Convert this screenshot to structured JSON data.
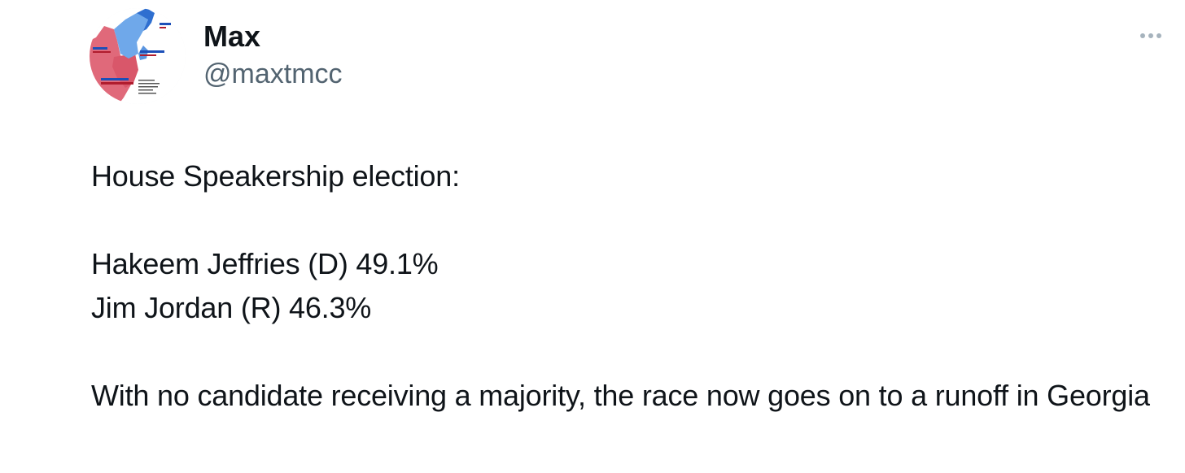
{
  "author": {
    "name": "Max",
    "handle": "@maxtmcc",
    "avatar_icon": "electoral-map-avatar"
  },
  "more_icon": "more-horizontal-icon",
  "tweet": {
    "line_intro": "House Speakership election:",
    "result_1": "Hakeem Jeffries (D) 49.1%",
    "result_2": "Jim Jordan (R) 46.3%",
    "conclusion": "With no candidate receiving a majority, the race now goes on to a runoff in Georgia"
  },
  "colors": {
    "text_primary": "#0f1419",
    "text_secondary": "#536471",
    "dem_blue": "#6fa8ea",
    "dem_dark": "#1c4fb8",
    "rep_red": "#e0697a",
    "rep_dark": "#b01c2e"
  }
}
